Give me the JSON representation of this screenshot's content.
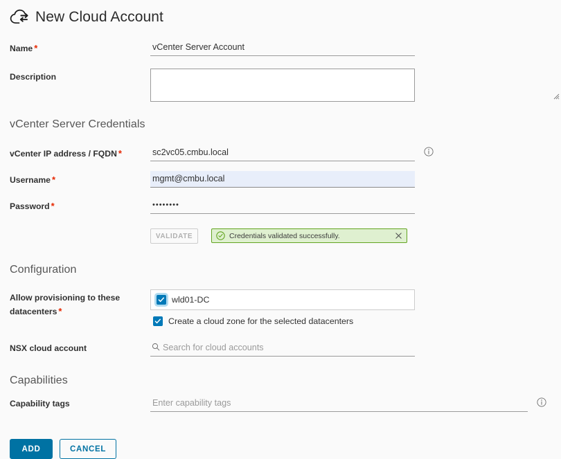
{
  "header": {
    "title": "New Cloud Account",
    "icon": "cloud-sync-icon"
  },
  "form": {
    "name": {
      "label": "Name",
      "required": true,
      "value": "vCenter Server Account",
      "placeholder": ""
    },
    "description": {
      "label": "Description",
      "required": false,
      "value": "",
      "placeholder": ""
    }
  },
  "credentials": {
    "section_title": "vCenter Server Credentials",
    "fqdn": {
      "label": "vCenter IP address / FQDN",
      "required": true,
      "value": "sc2vc05.cmbu.local",
      "placeholder": "",
      "info_icon": "info-icon"
    },
    "username": {
      "label": "Username",
      "required": true,
      "value": "mgmt@cmbu.local",
      "placeholder": ""
    },
    "password": {
      "label": "Password",
      "required": true,
      "value": "••••••••",
      "placeholder": ""
    },
    "validate_button": "VALIDATE",
    "validate_disabled": true,
    "alert": {
      "text": "Credentials validated successfully.",
      "type": "success",
      "icon": "check-circle-icon",
      "close_icon": "close-icon",
      "bg_color": "#dff0d0",
      "border_color": "#62a420"
    }
  },
  "configuration": {
    "section_title": "Configuration",
    "datacenters": {
      "label_line1": "Allow provisioning to these",
      "label_line2": "datacenters",
      "required": true,
      "options": [
        {
          "label": "wld01-DC",
          "checked": true,
          "focused": true
        }
      ]
    },
    "cloud_zone": {
      "label": "Create a cloud zone for the selected datacenters",
      "checked": true
    },
    "nsx_account": {
      "label": "NSX cloud account",
      "required": false,
      "value": "",
      "placeholder": "Search for cloud accounts",
      "icon": "search-icon"
    }
  },
  "capabilities": {
    "section_title": "Capabilities",
    "tags": {
      "label": "Capability tags",
      "required": false,
      "value": "",
      "placeholder": "Enter capability tags",
      "info_icon": "info-icon"
    }
  },
  "footer": {
    "add_label": "ADD",
    "cancel_label": "CANCEL"
  },
  "colors": {
    "accent": "#0072a3",
    "checkbox": "#0079b8",
    "required": "#e62700",
    "success_border": "#62a420",
    "success_bg": "#dff0d0",
    "autofill_bg": "#e8eefa",
    "page_bg": "#fafafa"
  }
}
